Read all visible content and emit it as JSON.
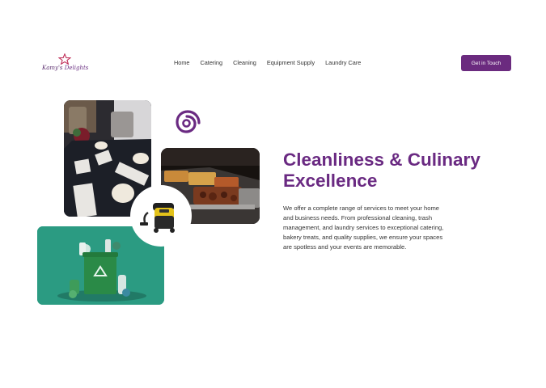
{
  "brand": {
    "name_part1": "Kamy's",
    "name_part2": "Delights"
  },
  "nav": {
    "items": [
      "Home",
      "Catering",
      "Cleaning",
      "Equipment Supply",
      "Laundry Care"
    ]
  },
  "cta": {
    "label": "Get in Touch"
  },
  "hero": {
    "title": "Cleanliness & Culinary Excellence",
    "description": "We offer a complete range of services to meet your home and business needs. From professional cleaning, trash management, and laundry services to exceptional catering, bakery treats, and quality supplies, we ensure your spaces are spotless and your events are memorable."
  },
  "colors": {
    "accent": "#6b2b7f",
    "teal": "#2a9c83"
  },
  "icons": [
    "star-icon",
    "spiral-icon",
    "vacuum-cleaner-icon",
    "recycle-icon"
  ]
}
